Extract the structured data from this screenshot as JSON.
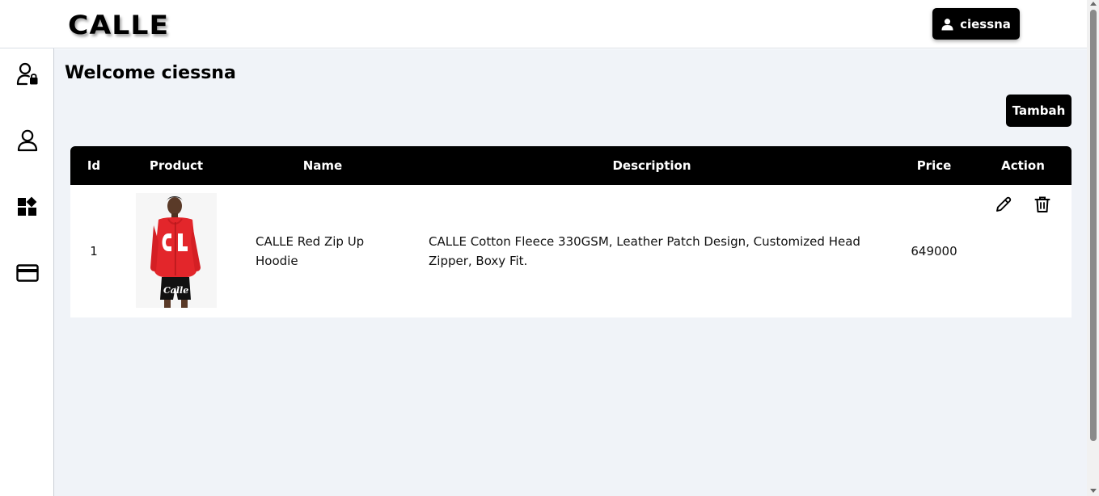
{
  "header": {
    "logo": "CALLE",
    "user_label": "ciessna",
    "user_icon": "user-icon"
  },
  "sidebar": {
    "items": [
      {
        "icon": "admin-lock-user-icon"
      },
      {
        "icon": "user-icon"
      },
      {
        "icon": "dashboard-widgets-icon"
      },
      {
        "icon": "credit-card-icon"
      }
    ]
  },
  "main": {
    "welcome": "Welcome ciessna",
    "add_button": "Tambah"
  },
  "table": {
    "columns": [
      "Id",
      "Product",
      "Name",
      "Description",
      "Price",
      "Action"
    ],
    "rows": [
      {
        "id": "1",
        "product_image": "red-zip-up-hoodie-photo",
        "name": "CALLE Red Zip Up Hoodie",
        "description": "CALLE Cotton Fleece 330GSM, Leather Patch Design, Customized Head Zipper, Boxy Fit.",
        "price": "649000",
        "actions": [
          "edit-pencil-icon",
          "delete-trash-icon"
        ]
      }
    ]
  },
  "colors": {
    "accent": "#000000",
    "background": "#f0f3f8",
    "product_red": "#e3262b"
  }
}
